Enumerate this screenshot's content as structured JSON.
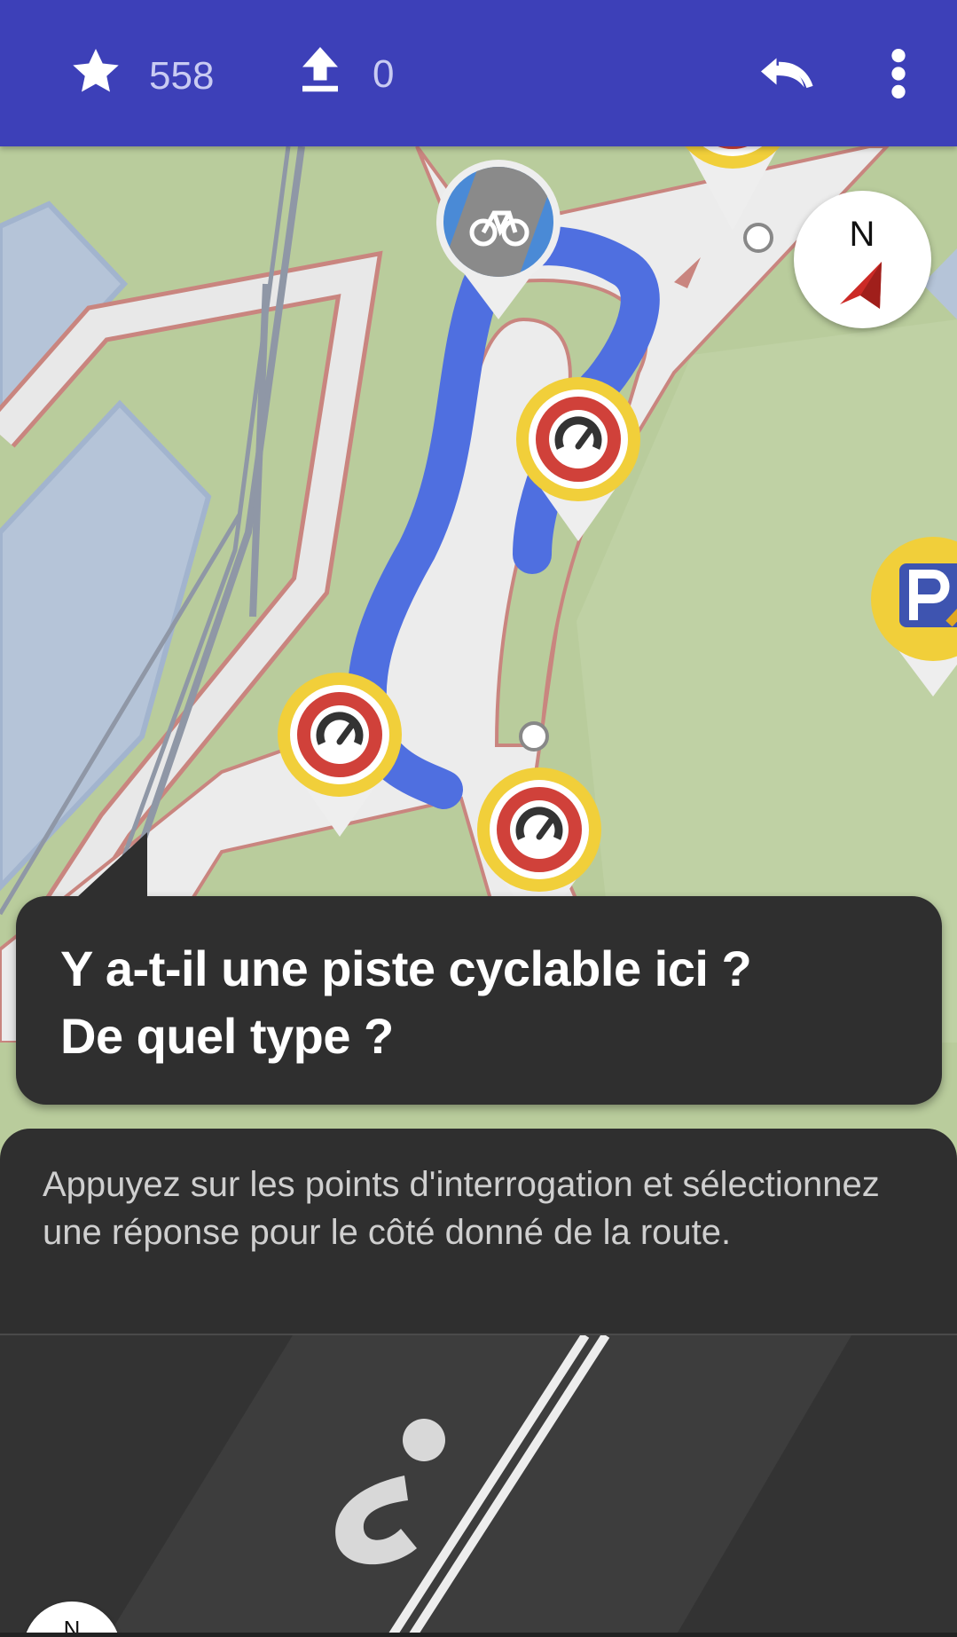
{
  "toolbar": {
    "star_count": "558",
    "upload_count": "0",
    "icons": [
      "star-icon",
      "upload-icon",
      "undo-icon",
      "more-vert-icon"
    ]
  },
  "compass": {
    "label": "N"
  },
  "quest": {
    "line1": "Y a-t-il une piste cyclable ici ?",
    "line2": "De quel type ?"
  },
  "panel": {
    "hint": "Appuyez sur les points d'interrogation et sélectionnez une réponse pour le côté donné de la route.",
    "compass_label": "N"
  },
  "colors": {
    "toolbar": "#3d40b8",
    "map_green": "#b9cc9c",
    "water": "#b5c4d8",
    "route": "#4f6fe0",
    "bubble": "#2f2f2f"
  }
}
